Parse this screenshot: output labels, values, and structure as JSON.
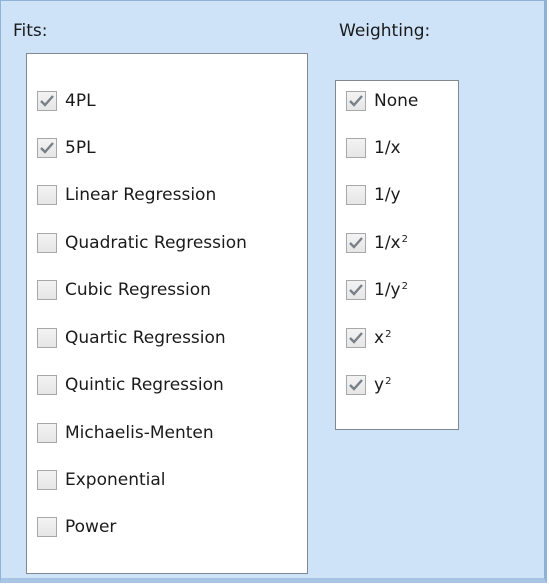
{
  "fits": {
    "title": "Fits:",
    "items": [
      {
        "label": "4PL",
        "checked": true
      },
      {
        "label": "5PL",
        "checked": true
      },
      {
        "label": "Linear Regression",
        "checked": false
      },
      {
        "label": "Quadratic Regression",
        "checked": false
      },
      {
        "label": "Cubic Regression",
        "checked": false
      },
      {
        "label": "Quartic Regression",
        "checked": false
      },
      {
        "label": "Quintic Regression",
        "checked": false
      },
      {
        "label": "Michaelis-Menten",
        "checked": false
      },
      {
        "label": "Exponential",
        "checked": false
      },
      {
        "label": "Power",
        "checked": false
      }
    ]
  },
  "weighting": {
    "title": "Weighting:",
    "items": [
      {
        "label": "None",
        "sup": "",
        "checked": true
      },
      {
        "label": "1/x",
        "sup": "",
        "checked": false
      },
      {
        "label": "1/y",
        "sup": "",
        "checked": false
      },
      {
        "label": "1/x",
        "sup": "2",
        "checked": true
      },
      {
        "label": "1/y",
        "sup": "2",
        "checked": true
      },
      {
        "label": "x",
        "sup": "2",
        "checked": true
      },
      {
        "label": "y",
        "sup": "2",
        "checked": true
      }
    ]
  },
  "colors": {
    "panel_background": "#cfe3f8",
    "list_background": "#ffffff",
    "check_mark": "#7a8088"
  }
}
